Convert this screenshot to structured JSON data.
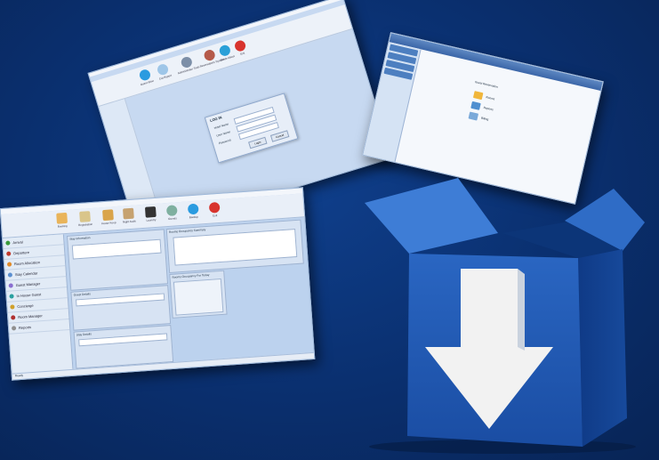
{
  "login_window": {
    "ribbon_labels": [
      "Guest Wise",
      "Cat Report",
      "Administrator Tools",
      "Reservations System",
      "Guide About",
      "Exit"
    ],
    "dialog": {
      "title": "LOG IN",
      "fields": [
        "Hotel Name",
        "User Name",
        "Password"
      ],
      "buttons": [
        "Login",
        "Cancel"
      ]
    }
  },
  "menu_window": {
    "items": [
      "Guest Reservation",
      "Rooms",
      "Reports",
      "Billing"
    ]
  },
  "dashboard_window": {
    "ribbon_labels": [
      "Booking",
      "Registration",
      "House Keep",
      "Night Audit",
      "Laundry",
      "Guests",
      "Backup",
      "Exit"
    ],
    "nav_items": [
      "Arrival",
      "Departure",
      "Room Allocation",
      "Stay Calendar",
      "Guest Manager",
      "In House Guest",
      "Concierge",
      "Room Manager",
      "Reports"
    ],
    "panel_titles": [
      "Stay Information",
      "Rooms Occupancy Summary",
      "Guest Details",
      "Rooms Occupancy For Today",
      "Stay Details"
    ],
    "status": "Ready"
  },
  "colors": {
    "background": "#0a2f6e",
    "box_front": "#1f56b0",
    "box_side": "#103d8a",
    "arrow": "#f2f2f2"
  },
  "icons": [
    "download-box-icon",
    "arrow-down-icon"
  ]
}
